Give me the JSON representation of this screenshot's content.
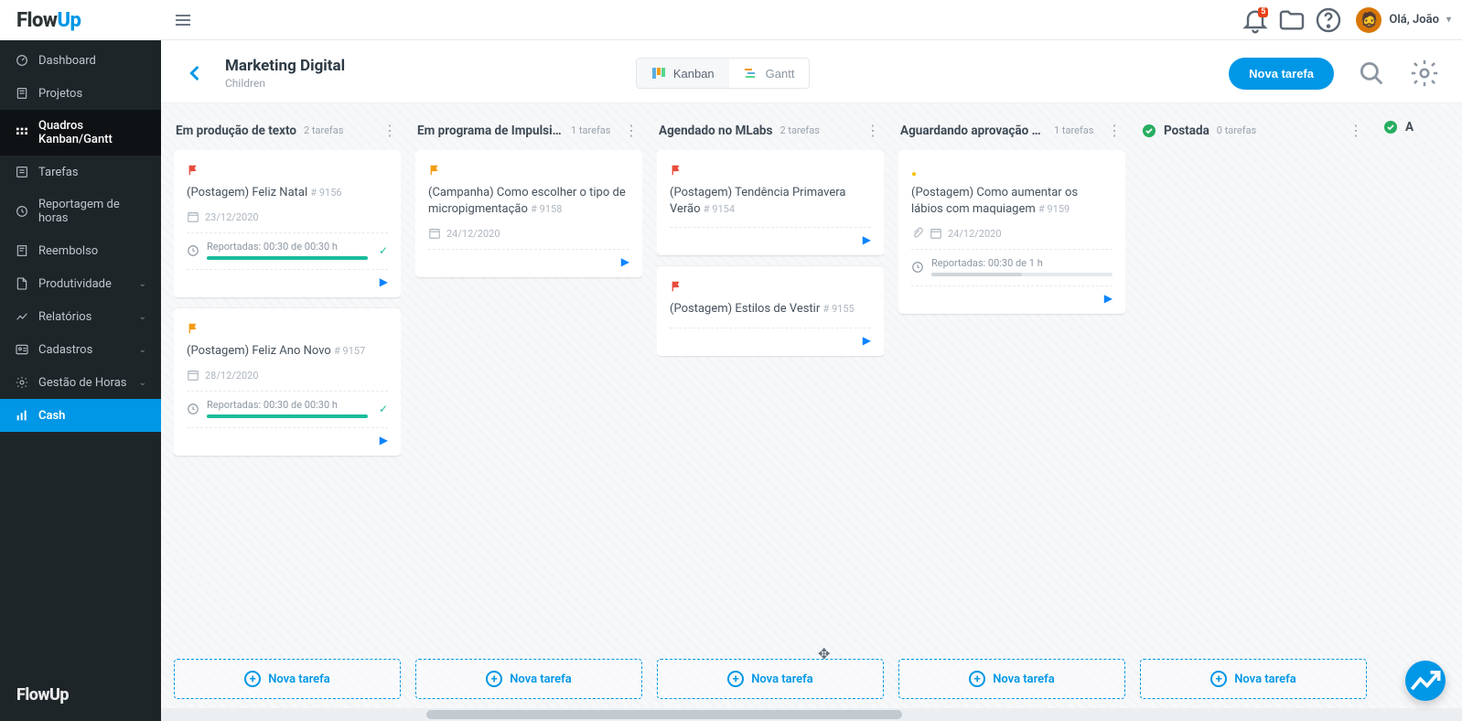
{
  "brand": {
    "part1": "Flow",
    "part2": "Up"
  },
  "topbar": {
    "notification_count": "5",
    "user_greeting": "Olá, João"
  },
  "sidebar": {
    "items": [
      {
        "label": "Dashboard",
        "icon": "dashboard-icon"
      },
      {
        "label": "Projetos",
        "icon": "projects-icon"
      },
      {
        "label": "Quadros Kanban/Gantt",
        "icon": "boards-icon",
        "active": true
      },
      {
        "label": "Tarefas",
        "icon": "tasks-icon"
      },
      {
        "label": "Reportagem de horas",
        "icon": "clock-icon"
      },
      {
        "label": "Reembolso",
        "icon": "receipt-icon"
      },
      {
        "label": "Produtividade",
        "icon": "file-icon",
        "expandable": true
      },
      {
        "label": "Relatórios",
        "icon": "chart-icon",
        "expandable": true
      },
      {
        "label": "Cadastros",
        "icon": "id-icon",
        "expandable": true
      },
      {
        "label": "Gestão de Horas",
        "icon": "gear-icon",
        "expandable": true
      },
      {
        "label": "Cash",
        "icon": "bar-icon",
        "highlight": true
      }
    ]
  },
  "header": {
    "title": "Marketing Digital",
    "subtitle": "Children",
    "view_kanban": "Kanban",
    "view_gantt": "Gantt",
    "new_task": "Nova tarefa"
  },
  "board": {
    "new_task_label": "Nova tarefa",
    "columns": [
      {
        "title": "Em produção de texto",
        "count": "2 tarefas",
        "cards": [
          {
            "flag": "red",
            "title": "(Postagem) Feliz Natal",
            "id": "# 9156",
            "date": "23/12/2020",
            "reported": "Reportadas: 00:30 de 00:30 h",
            "progress": 100,
            "progress_color": "teal",
            "done": true,
            "play": true
          },
          {
            "flag": "orange",
            "title": "(Postagem) Feliz Ano Novo",
            "id": "# 9157",
            "date": "28/12/2020",
            "reported": "Reportadas: 00:30 de 00:30 h",
            "progress": 100,
            "progress_color": "teal",
            "done": true,
            "play": true
          }
        ]
      },
      {
        "title": "Em programa de Impulsio...",
        "count": "1 tarefas",
        "cards": [
          {
            "flag": "orange",
            "title": "(Campanha) Como escolher o tipo de micropigmentação",
            "id": "# 9158",
            "date": "24/12/2020",
            "play": true
          }
        ]
      },
      {
        "title": "Agendado no MLabs",
        "count": "2 tarefas",
        "cards": [
          {
            "flag": "red",
            "title": "(Postagem) Tendência Primavera Verão",
            "id": "# 9154",
            "play": true
          },
          {
            "flag": "red",
            "title": "(Postagem) Estilos de Vestir",
            "id": "# 9155",
            "play": true
          }
        ]
      },
      {
        "title": "Aguardando aprovação d...",
        "count": "1 tarefas",
        "cards": [
          {
            "flag": "yellowdot",
            "title": "(Postagem) Como aumentar os lábios com maquiagem",
            "id": "# 9159",
            "date": "24/12/2020",
            "attach": true,
            "reported": "Reportadas: 00:30 de 1 h",
            "progress": 50,
            "progress_color": "gray",
            "play": true
          }
        ]
      },
      {
        "title": "Postada",
        "count": "0 tarefas",
        "check": true,
        "cards": []
      },
      {
        "title": "A",
        "count": "",
        "check": true,
        "partial": true,
        "cards": []
      }
    ]
  }
}
